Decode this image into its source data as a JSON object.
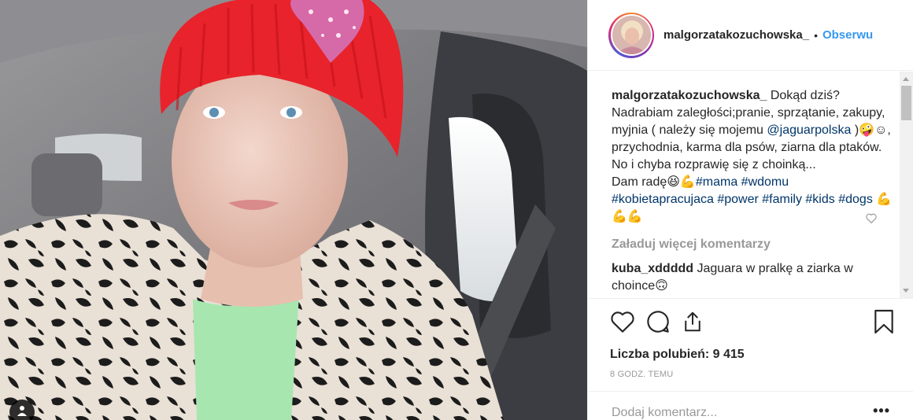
{
  "post": {
    "username": "malgorzatakozuchowska_",
    "follow_label": "Obserwu",
    "dot": "•"
  },
  "caption": {
    "username": "malgorzatakozuchowska_",
    "text_1": " Dokąd dziś? Nadrabiam zaległości;pranie, sprzątanie, zakupy, myjnia ( należy się mojemu ",
    "mention": "@jaguarpolska",
    "text_2": " )🤪☺, przychodnia, karma dla psów, ziarna dla ptaków. No i chyba rozprawię się z choinką...",
    "text_3": "Dam radę😆💪",
    "hashtags": [
      "#mama",
      "#wdomu",
      "#kobietapracujaca",
      "#power",
      "#family",
      "#kids",
      "#dogs"
    ],
    "emoji_tail": "💪💪💪"
  },
  "load_more": "Załaduj więcej komentarzy",
  "comment": {
    "username": "kuba_xddddd",
    "text": " Jaguara w pralkę a ziarka w choince🙃"
  },
  "likes_label": "Liczba polubień: 9 415",
  "timestamp": "8 GODZ. TEMU",
  "add_comment_placeholder": "Dodaj komentarz...",
  "more_options": "•••",
  "colors": {
    "accent": "#3897f0",
    "hashtag": "#003569",
    "muted": "#999999"
  }
}
